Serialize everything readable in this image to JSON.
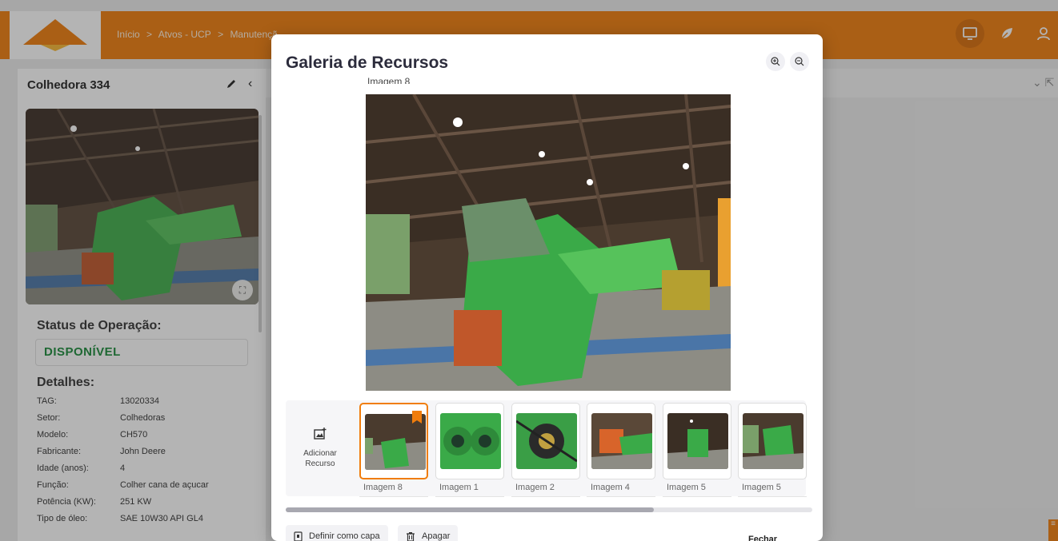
{
  "header": {
    "breadcrumbs": [
      "Início",
      ">",
      "Atvos - UCP",
      ">",
      "Manutençã"
    ],
    "icons": [
      "monitor-icon",
      "leaf-icon",
      "user-icon"
    ]
  },
  "asset": {
    "title": "Colhedora 334",
    "status_title": "Status de Operação:",
    "status": "DISPONÍVEL",
    "details_title": "Detalhes:",
    "details": [
      {
        "key": "TAG:",
        "value": "13020334"
      },
      {
        "key": "Setor:",
        "value": "Colhedoras"
      },
      {
        "key": "Modelo:",
        "value": "CH570"
      },
      {
        "key": "Fabricante:",
        "value": "John Deere"
      },
      {
        "key": "Idade (anos):",
        "value": "4"
      },
      {
        "key": "Função:",
        "value": "Colher cana de açucar"
      },
      {
        "key": "Potência (KW):",
        "value": "251 KW"
      },
      {
        "key": "Tipo de óleo:",
        "value": "SAE 10W30 API GL4"
      }
    ]
  },
  "modal": {
    "title": "Galeria de Recursos",
    "current_image_label": "Imagem 8",
    "add_resource_label": "Adicionar Recurso",
    "thumbnails": [
      {
        "label": "Imagem 8",
        "selected": true
      },
      {
        "label": "Imagem 1",
        "selected": false
      },
      {
        "label": "Imagem 2",
        "selected": false
      },
      {
        "label": "Imagem 4",
        "selected": false
      },
      {
        "label": "Imagem 5",
        "selected": false
      },
      {
        "label": "Imagem 5",
        "selected": false
      }
    ],
    "set_cover_label": "Definir como capa",
    "delete_label": "Apagar",
    "close_label": "Fechar"
  },
  "colors": {
    "brand": "#f07d0c",
    "status_ok": "#1a8a3a"
  }
}
